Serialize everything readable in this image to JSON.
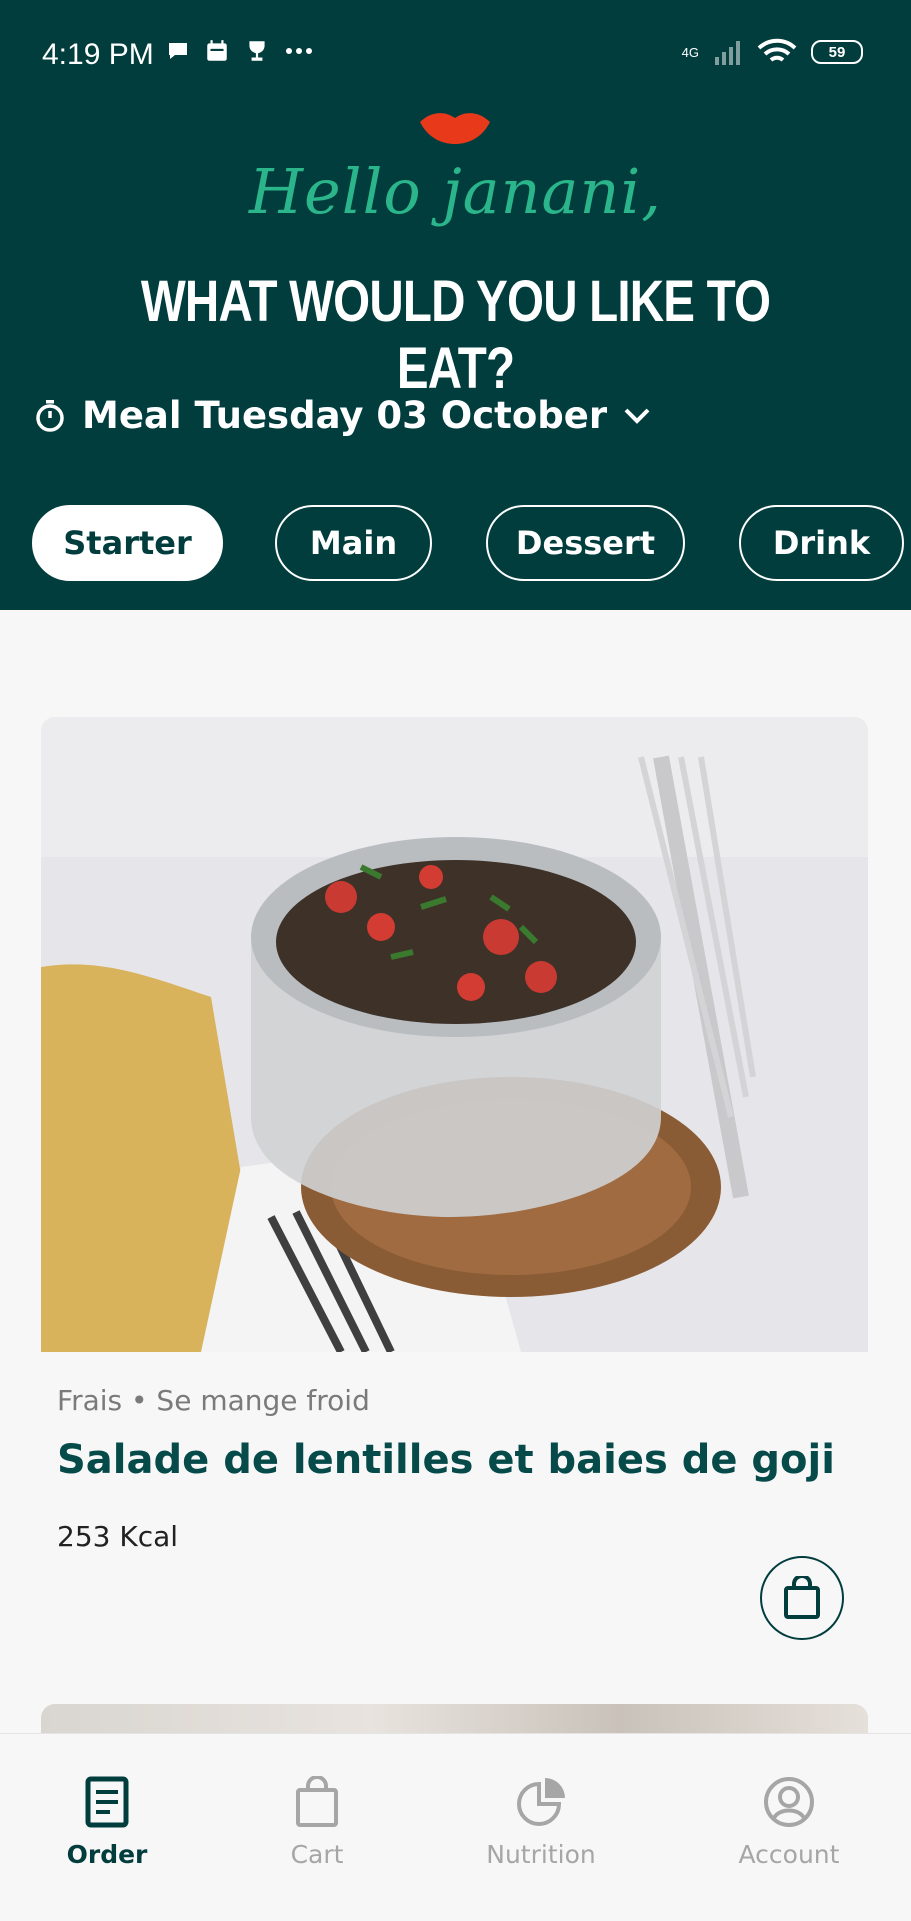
{
  "status_bar": {
    "time": "4:19 PM",
    "network": "4G",
    "battery": "59"
  },
  "header": {
    "greeting": "Hello janani,",
    "headline": "WHAT WOULD YOU LIKE TO EAT?",
    "meal_label": "Meal Tuesday 03 October",
    "colors": {
      "background": "#023d3e",
      "accent": "#2bb58a",
      "lips": "#e8391b"
    }
  },
  "tabs": [
    {
      "label": "Starter",
      "active": true
    },
    {
      "label": "Main",
      "active": false
    },
    {
      "label": "Dessert",
      "active": false
    },
    {
      "label": "Drink",
      "active": false
    }
  ],
  "card": {
    "meta": "Frais • Se mange froid",
    "title": "Salade de lentilles et baies de goji",
    "kcal": "253 Kcal"
  },
  "bottom_nav": [
    {
      "label": "Order",
      "icon": "order-icon",
      "active": true
    },
    {
      "label": "Cart",
      "icon": "bag-icon",
      "active": false
    },
    {
      "label": "Nutrition",
      "icon": "pie-chart-icon",
      "active": false
    },
    {
      "label": "Account",
      "icon": "account-icon",
      "active": false
    }
  ]
}
